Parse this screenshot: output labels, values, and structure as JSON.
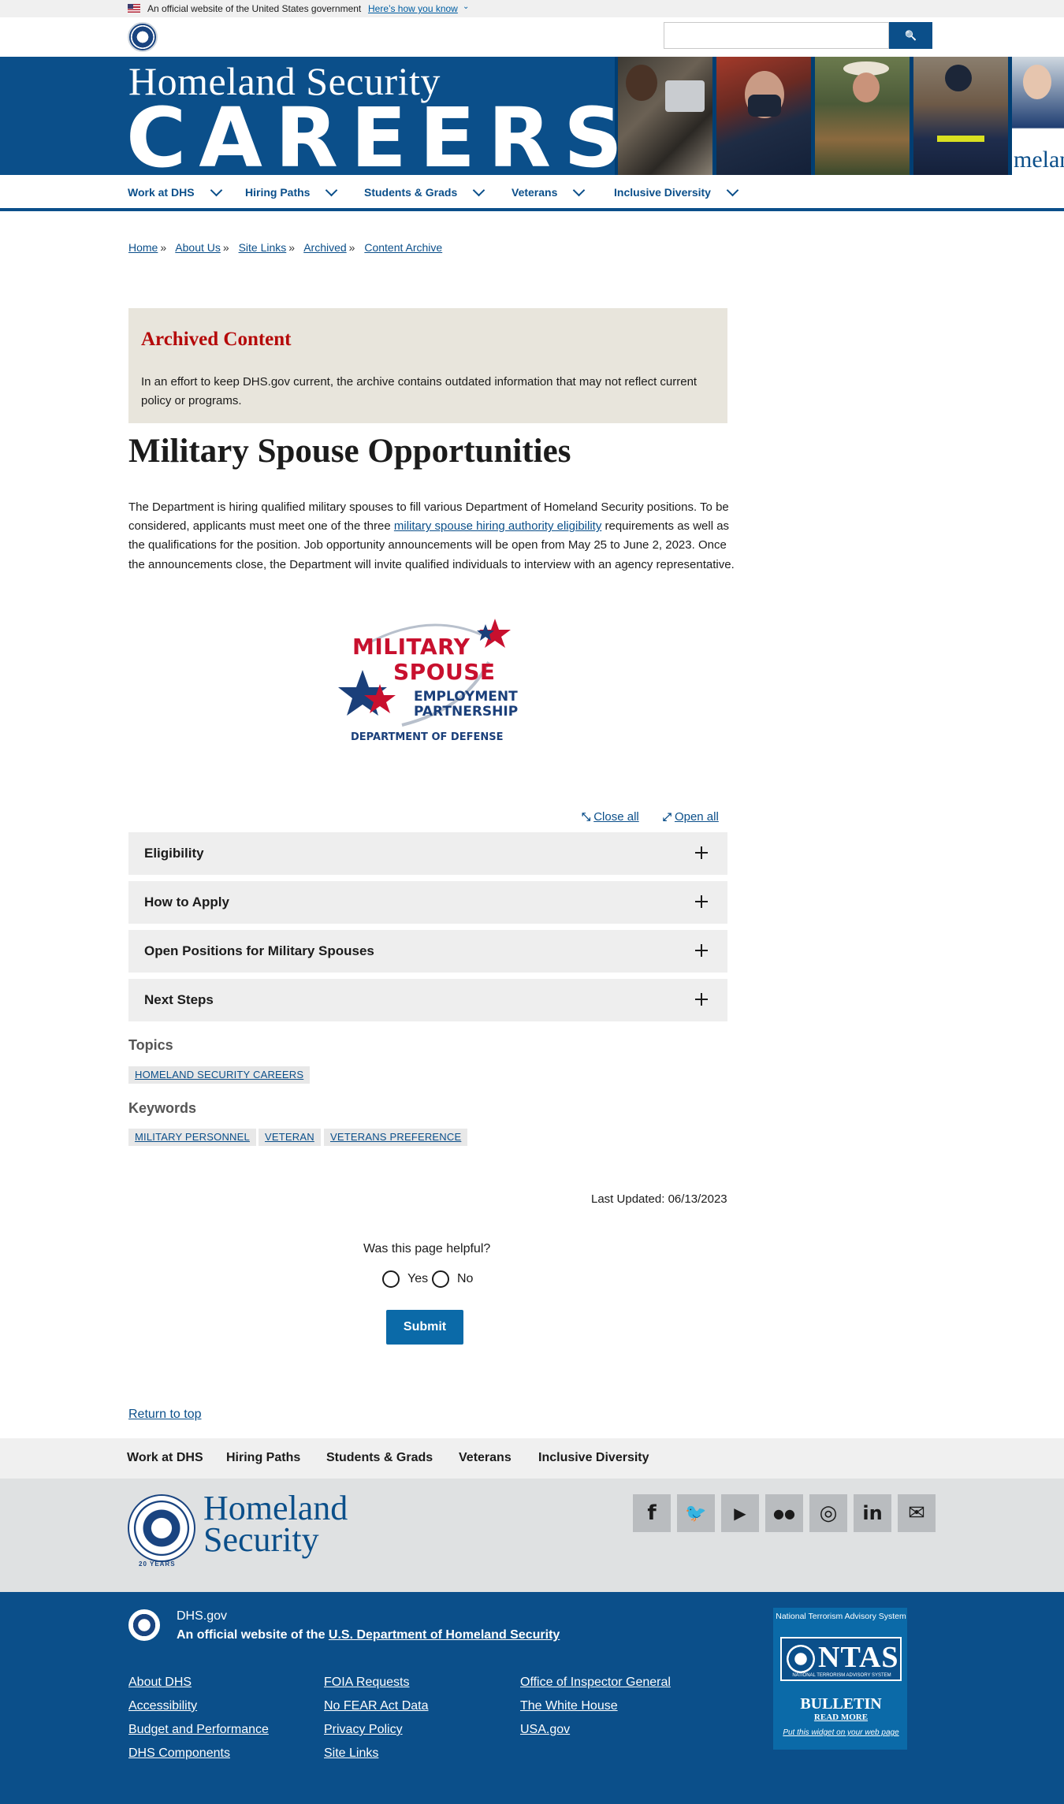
{
  "gov_banner": {
    "text": "An official website of the United States government",
    "link": "Here’s how you know",
    "chevron": "⌄"
  },
  "header": {
    "search_placeholder": "",
    "search_icon": "search-icon",
    "search_glyph": "🔍"
  },
  "hero": {
    "line1": "Homeland Security",
    "line2": "CAREERS",
    "photo5_text": "melan"
  },
  "nav": {
    "items": [
      {
        "label": "Work at DHS"
      },
      {
        "label": "Hiring Paths"
      },
      {
        "label": "Students & Grads"
      },
      {
        "label": "Veterans"
      },
      {
        "label": "Inclusive Diversity"
      }
    ]
  },
  "breadcrumb": {
    "items": [
      "Home",
      "About Us",
      "Site Links",
      "Archived",
      "Content Archive"
    ],
    "separator": "»"
  },
  "archived": {
    "title": "Archived Content",
    "text": "In an effort to keep DHS.gov current, the archive contains outdated information that may not reflect current policy or programs."
  },
  "page": {
    "title": "Military Spouse Opportunities",
    "body_before_link": "The Department is hiring qualified military spouses to fill various Department of Homeland Security positions. To be considered, applicants must meet one of the three ",
    "body_link": "military spouse hiring authority eligibility",
    "body_after_link": " requirements as well as the qualifications for the position. Job opportunity announcements will be open from May 25 to June 2, 2023. Once the announcements close, the Department will invite qualified individuals to interview with an agency representative."
  },
  "logo": {
    "line1": "MILITARY",
    "line2": "SPOUSE",
    "line3": "EMPLOYMENT",
    "line4": "PARTNERSHIP",
    "line5": "DEPARTMENT OF DEFENSE",
    "red": "#c8102e",
    "blue": "#1a3f7a"
  },
  "accordion": {
    "close_all": "Close all",
    "open_all": "Open all",
    "items": [
      {
        "label": "Eligibility"
      },
      {
        "label": "How to Apply"
      },
      {
        "label": "Open Positions for Military Spouses"
      },
      {
        "label": "Next Steps"
      }
    ]
  },
  "topics": {
    "heading": "Topics",
    "tags": [
      "HOMELAND SECURITY CAREERS"
    ]
  },
  "keywords": {
    "heading": "Keywords",
    "tags": [
      "MILITARY PERSONNEL",
      "VETERAN",
      "VETERANS PREFERENCE"
    ]
  },
  "last_updated": "Last Updated: 06/13/2023",
  "feedback": {
    "question": "Was this page helpful?",
    "yes": "Yes",
    "no": "No",
    "submit": "Submit"
  },
  "return_to_top": "Return to top",
  "footer_nav": {
    "items": [
      "Work at DHS",
      "Hiring Paths",
      "Students & Grads",
      "Veterans",
      "Inclusive Diversity"
    ]
  },
  "footer_brand": {
    "word1": "Homeland",
    "word2": "Security",
    "seal_years": "20 YEARS",
    "social": [
      {
        "name": "facebook-icon",
        "glyph": "f"
      },
      {
        "name": "twitter-icon",
        "glyph": "🐦"
      },
      {
        "name": "youtube-icon",
        "glyph": "▶"
      },
      {
        "name": "flickr-icon",
        "glyph": "●●"
      },
      {
        "name": "instagram-icon",
        "glyph": "◎"
      },
      {
        "name": "linkedin-icon",
        "glyph": "in"
      },
      {
        "name": "email-icon",
        "glyph": "✉"
      }
    ]
  },
  "footer": {
    "site": "DHS.gov",
    "official_prefix": "An official website of the ",
    "official_link": "U.S. Department of Homeland Security",
    "col1": [
      "About DHS",
      "Accessibility",
      "Budget and Performance",
      "DHS Components"
    ],
    "col2": [
      "FOIA Requests",
      "No FEAR Act Data",
      "Privacy Policy",
      "Site Links"
    ],
    "col3": [
      "Office of Inspector General",
      "The White House",
      "USA.gov"
    ],
    "ntas": {
      "title": "National Terrorism Advisory System",
      "word": "NTAS",
      "small": "NATIONAL TERRORISM ADVISORY SYSTEM",
      "bulletin": "BULLETIN",
      "read_more": "READ MORE",
      "widget": "Put this widget on your web page"
    }
  },
  "colors": {
    "brand_blue": "#0b4f8a",
    "archived_red": "#b50909",
    "archived_bg": "#e8e5dc"
  }
}
